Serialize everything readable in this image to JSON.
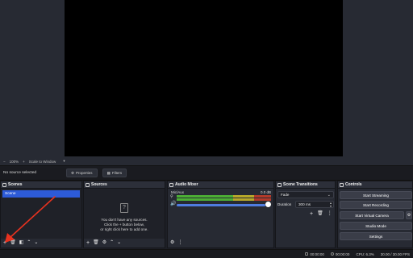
{
  "preview": {
    "zoom_level": "100%",
    "scale_mode": "Scale to Window"
  },
  "source_toolbar": {
    "status": "No source selected",
    "properties_label": "Properties",
    "filters_label": "Filters"
  },
  "scenes": {
    "title": "Scenes",
    "items": [
      "Scene"
    ]
  },
  "sources": {
    "title": "Sources",
    "empty_line1": "You don't have any sources.",
    "empty_line2": "Click the + button below,",
    "empty_line3": "or right click here to add one."
  },
  "mixer": {
    "title": "Audio Mixer",
    "channel_name": "Mic/Aux",
    "channel_db": "0.0 dB"
  },
  "transitions": {
    "title": "Scene Transitions",
    "selected": "Fade",
    "duration_label": "Duration",
    "duration_value": "300 ms"
  },
  "controls": {
    "title": "Controls",
    "start_streaming": "Start Streaming",
    "start_recording": "Start Recording",
    "start_virtual_camera": "Start Virtual Camera",
    "studio_mode": "Studio Mode",
    "settings": "Settings"
  },
  "status": {
    "stream_time": "00:00:00",
    "record_time": "00:00:00",
    "cpu": "CPU: 6.3%",
    "fps": "30.00 / 30.00 FPS"
  },
  "colors": {
    "accent": "#2d5bd8",
    "annotation_arrow": "#e8321f"
  },
  "icons": {
    "add": "+",
    "remove": "trash-icon",
    "filters": "filters-icon",
    "up": "^",
    "down": "v",
    "gear": "⚙"
  }
}
